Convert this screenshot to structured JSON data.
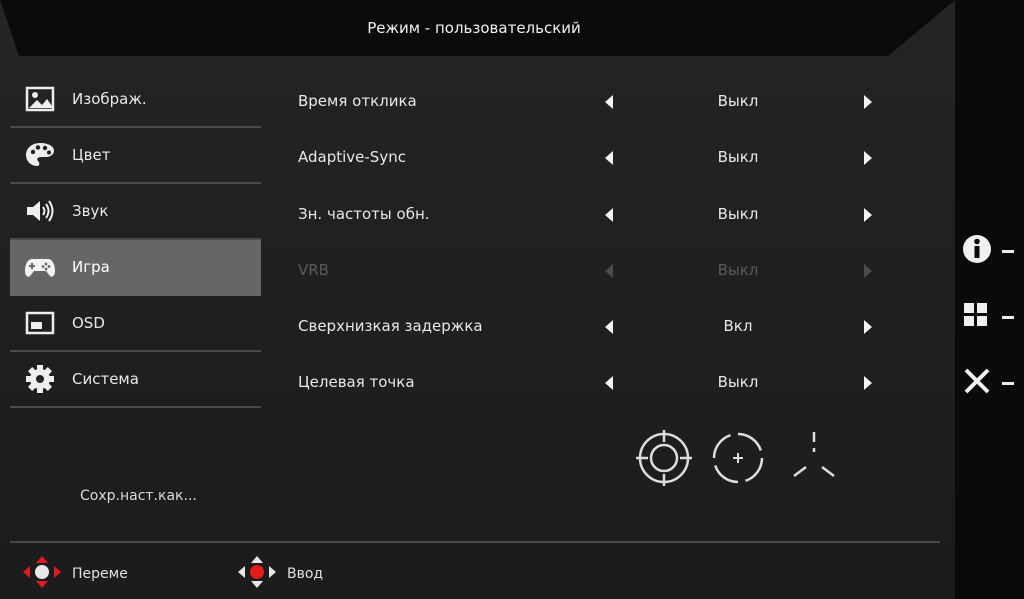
{
  "title": "Режим - пользовательский",
  "menu": [
    {
      "label": "Изображ.",
      "icon": "image-icon",
      "active": false
    },
    {
      "label": "Цвет",
      "icon": "palette-icon",
      "active": false
    },
    {
      "label": "Звук",
      "icon": "speaker-icon",
      "active": false
    },
    {
      "label": "Игра",
      "icon": "gamepad-icon",
      "active": true
    },
    {
      "label": "OSD",
      "icon": "osd-window-icon",
      "active": false
    },
    {
      "label": "Система",
      "icon": "gear-icon",
      "active": false
    }
  ],
  "save_as": "Сохр.наст.как...",
  "settings": [
    {
      "label": "Время отклика",
      "value": "Выкл",
      "enabled": true
    },
    {
      "label": "Adaptive-Sync",
      "value": "Выкл",
      "enabled": true
    },
    {
      "label": "Зн. частоты обн.",
      "value": "Выкл",
      "enabled": true
    },
    {
      "label": "VRB",
      "value": "Выкл",
      "enabled": false
    },
    {
      "label": "Сверхнизкая задержка",
      "value": "Вкл",
      "enabled": true
    },
    {
      "label": "Целевая точка",
      "value": "Выкл",
      "enabled": true
    }
  ],
  "crosshair_options": [
    "crosshair-circle-icon",
    "crosshair-dashed-icon",
    "crosshair-tri-icon"
  ],
  "footer": {
    "move_label": "Переме",
    "enter_label": "Ввод"
  },
  "side_keys": [
    "info-icon",
    "grid-icon",
    "close-icon"
  ],
  "colors": {
    "accent": "#e31b1b",
    "active_bg": "#666666",
    "panel_bg": "#222222"
  }
}
